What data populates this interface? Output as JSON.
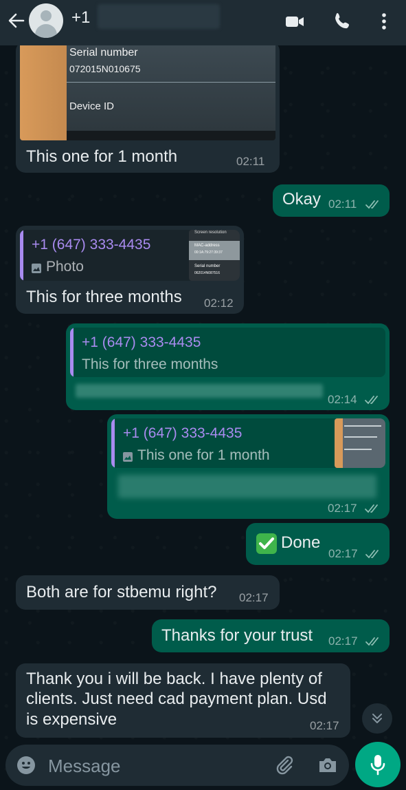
{
  "header": {
    "contact": "+1",
    "colors": {
      "bar": "#1f2c34",
      "accent": "#00a884"
    }
  },
  "image_card": {
    "serial_label": "Serial number",
    "serial_value": "072015N010675",
    "device_label": "Device ID"
  },
  "messages": [
    {
      "text": "This one for 1 month",
      "time": "02:11"
    },
    {
      "text": "Okay",
      "time": "02:11"
    },
    {
      "quote_name": "+1 (647) 333-4435",
      "quote_text": "Photo",
      "text": "This for three months",
      "time": "02:12",
      "thumb": {
        "line1": "Screen resolution",
        "line2": "MAC-address",
        "line3": "00:1A:79:27:39:37",
        "line4": "Serial number",
        "line5": "062014N087516"
      }
    },
    {
      "quote_name": "+1 (647) 333-4435",
      "quote_text": "This for three months",
      "time": "02:14"
    },
    {
      "quote_name": "+1 (647) 333-4435",
      "quote_text": "This one for 1 month",
      "time": "02:17"
    },
    {
      "text": "Done",
      "time": "02:17"
    },
    {
      "text": "Both are for stbemu right?",
      "time": "02:17"
    },
    {
      "text": "Thanks for your trust",
      "time": "02:17"
    },
    {
      "lines": [
        "Thank you i will be back. I have plenty of",
        "clients. Just need cad payment plan. Usd",
        "is expensive"
      ],
      "time": "02:17"
    }
  ],
  "input": {
    "placeholder": "Message"
  }
}
